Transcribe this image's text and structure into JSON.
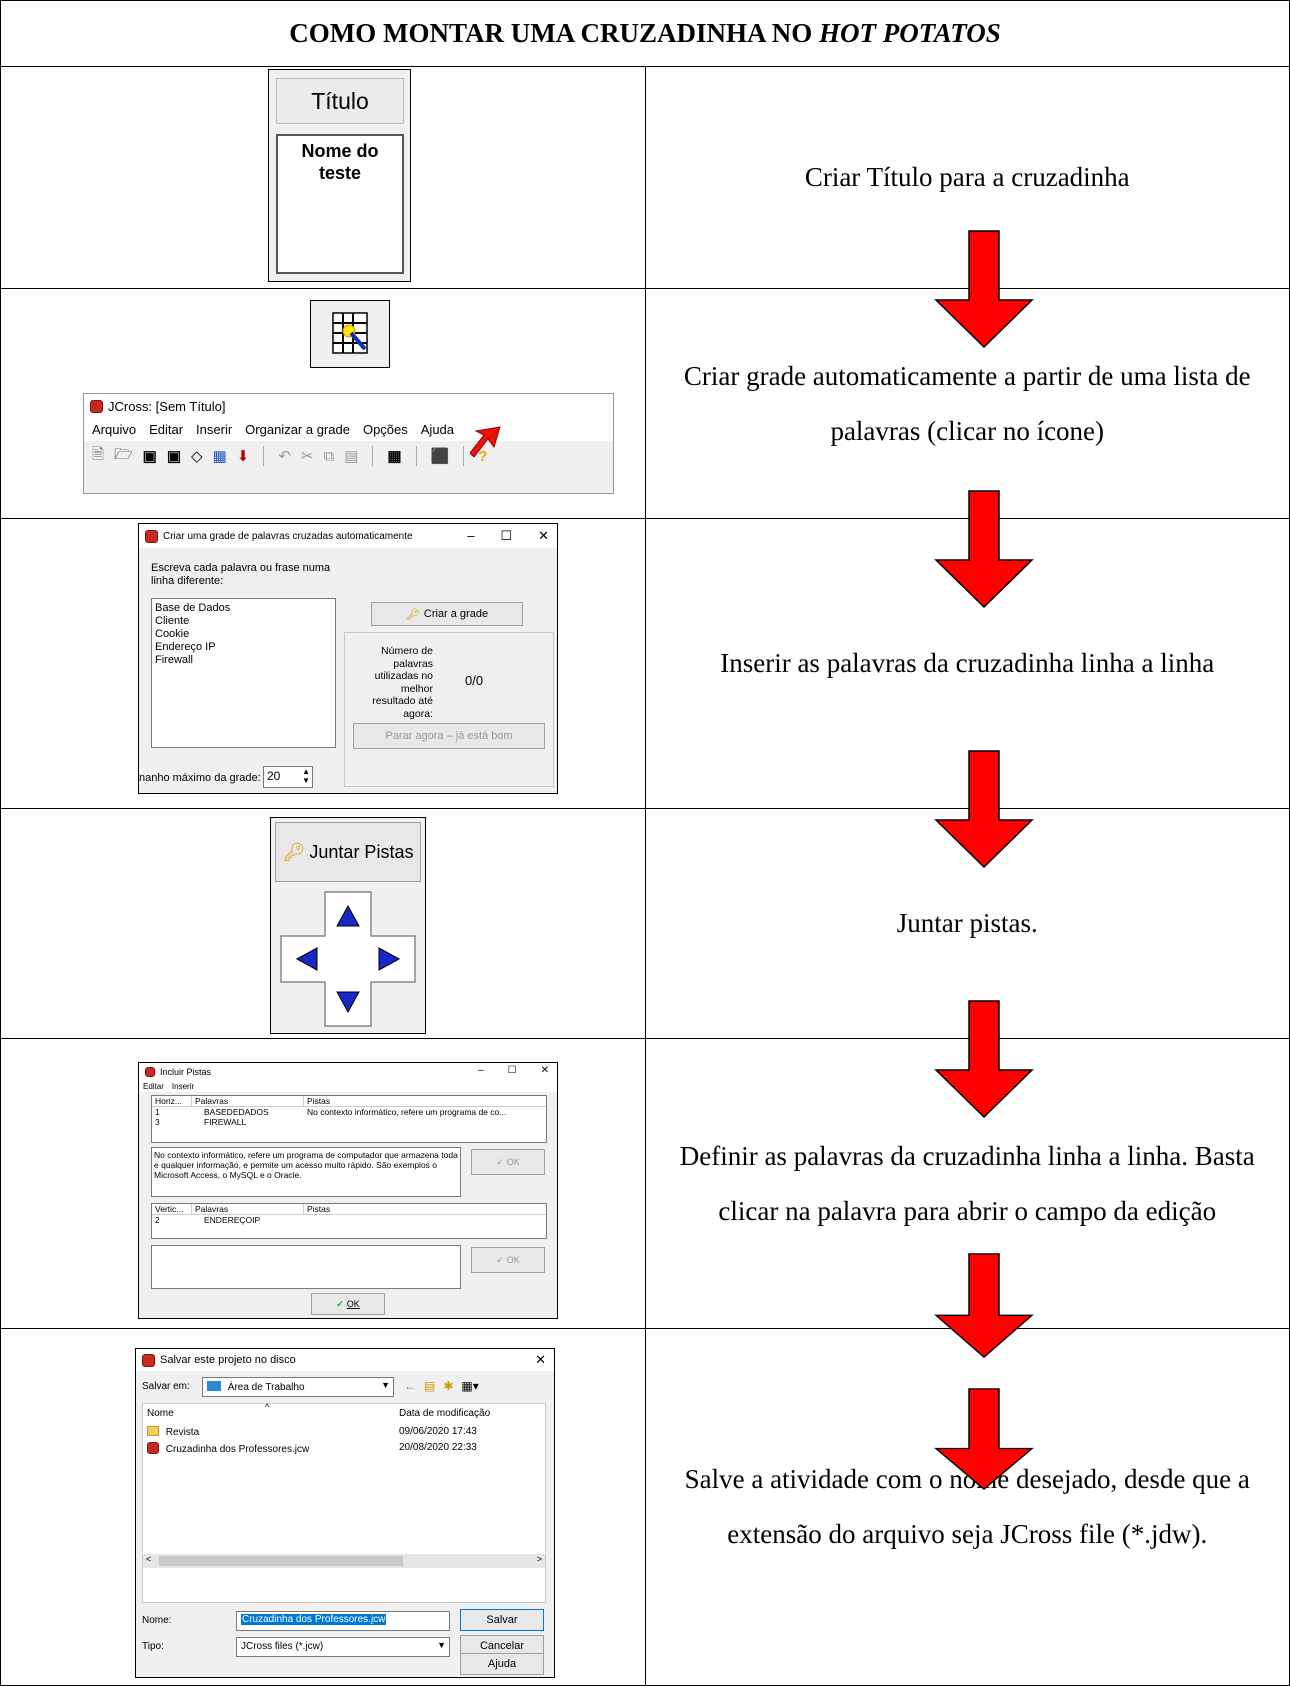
{
  "header": {
    "title_prefix": "COMO MONTAR UMA CRUZADINHA NO ",
    "title_italic": "HOT POTATOS"
  },
  "steps": [
    {
      "text": "Criar Título para a cruzadinha"
    },
    {
      "text": "Criar grade automaticamente a partir de uma lista de palavras (clicar no ícone)"
    },
    {
      "text": "Inserir as palavras da cruzadinha linha a linha"
    },
    {
      "text": "Juntar pistas."
    },
    {
      "text": "Definir as palavras da cruzadinha linha a linha. Basta clicar na palavra para abrir o campo da edição"
    },
    {
      "text": "Salve a atividade com o nome desejado, desde que a extensão do arquivo seja JCross file (*.jdw)."
    }
  ],
  "shot1": {
    "title_button": "Título",
    "name_text": "Nome do teste"
  },
  "shot2": {
    "window_title": "JCross: [Sem Título]",
    "menu": [
      "Arquivo",
      "Editar",
      "Inserir",
      "Organizar a grade",
      "Opções",
      "Ajuda"
    ]
  },
  "shot3": {
    "window_title": "Criar uma grade de palavras cruzadas automaticamente",
    "instruction": "Escreva cada palavra ou frase numa linha diferente:",
    "words": [
      "Base de Dados",
      "Cliente",
      "Cookie",
      "Endereço IP",
      "Firewall"
    ],
    "create_button": "Criar a grade",
    "count_label": "Número de palavras utilizadas no melhor resultado até agora:",
    "count_value": "0/0",
    "stop_button": "Parar agora – já está bom",
    "size_label": "nanho máximo da grade:",
    "size_value": "20"
  },
  "shot4": {
    "join_button": "Juntar Pistas"
  },
  "shot5": {
    "window_title": "Incluir Pistas",
    "menu": [
      "Editar",
      "Inserir"
    ],
    "h_columns": [
      "Horiz...",
      "Palavras",
      "Pistas"
    ],
    "h_rows": [
      {
        "num": "1",
        "word": "BASEDEDADOS",
        "clue": "No contexto informático, refere um programa de co..."
      },
      {
        "num": "3",
        "word": "FIREWALL",
        "clue": ""
      }
    ],
    "clue_text": "No contexto informático, refere um programa de computador que armazena toda e qualquer informação, e permite um acesso muito rápido. São exemplos o Microsoft Access, o MySQL e o Oracle.",
    "ok_small": "OK",
    "v_columns": [
      "Vertic...",
      "Palavras",
      "Pistas"
    ],
    "v_rows": [
      {
        "num": "2",
        "word": "ENDEREÇOIP",
        "clue": ""
      }
    ],
    "ok_button": "OK"
  },
  "shot6": {
    "window_title": "Salvar este projeto no disco",
    "save_in_label": "Salvar em:",
    "save_in_value": "Área de Trabalho",
    "col_name": "Nome",
    "col_date": "Data de modificação",
    "files": [
      {
        "name": "Revista",
        "date": "09/06/2020 17:43"
      },
      {
        "name": "Cruzadinha dos Professores.jcw",
        "date": "20/08/2020 22:33"
      }
    ],
    "name_label": "Nome:",
    "name_value": "Cruzadinha dos Professores.jcw",
    "type_label": "Tipo:",
    "type_value": "JCross files (*.jcw)",
    "save_button": "Salvar",
    "cancel_button": "Cancelar",
    "help_button": "Ajuda"
  },
  "colors": {
    "arrow": "#ff0000",
    "arrow_outline": "#000000",
    "selection": "#0078d7"
  }
}
